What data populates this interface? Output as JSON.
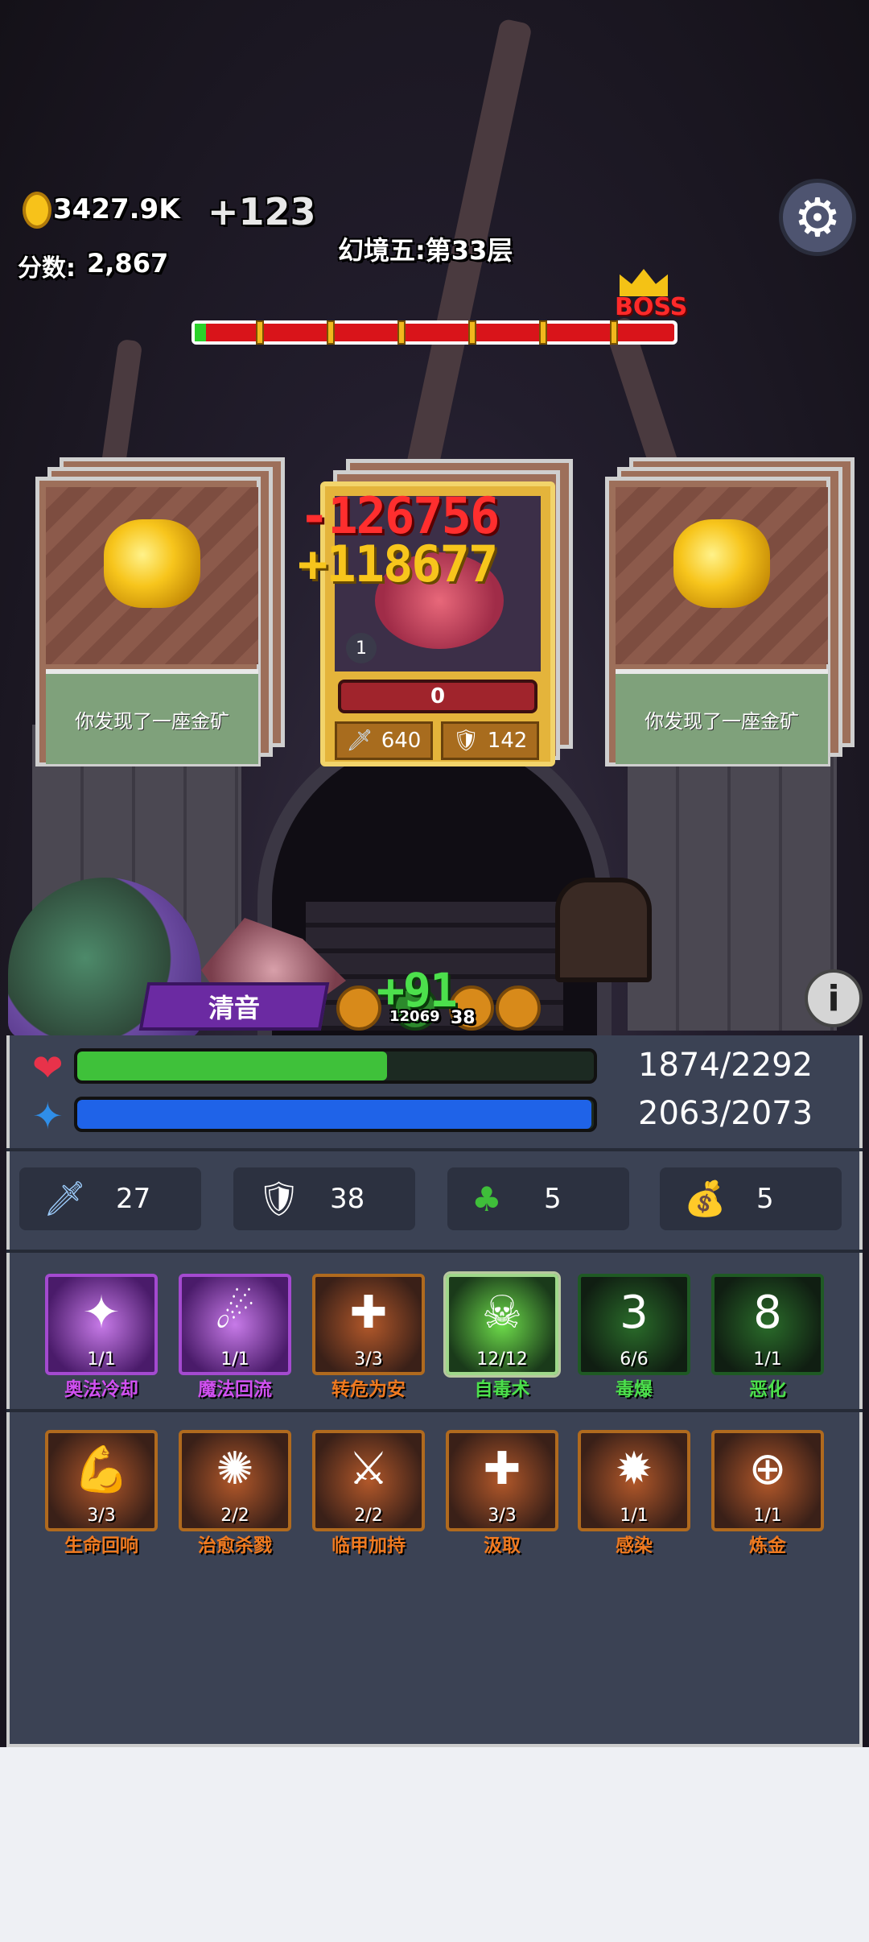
{
  "hud": {
    "coins": "3427.9K",
    "coin_gain": "+123",
    "score_label": "分数:",
    "score": "2,867",
    "stage_title": "幻境五:第33层",
    "boss_label": "BOSS",
    "stage_progress": 0.02
  },
  "cards": [
    {
      "label": "你发现了一座金矿",
      "art": "gold-ore"
    },
    {
      "label": "你发现了一座金矿",
      "art": "gold-ore"
    }
  ],
  "enemy": {
    "level": "1",
    "hp": "0",
    "attack": "640",
    "defense": "142",
    "damage_text": "-126756",
    "heal_text": "+118677"
  },
  "hero": {
    "name": "清音",
    "heal_popup": "+91",
    "buff_values": [
      "12069",
      "38"
    ]
  },
  "bars": {
    "hp": {
      "text": "1874/2292",
      "fraction": 0.6,
      "color": "#3fc13a"
    },
    "mp": {
      "text": "2063/2073",
      "fraction": 0.995,
      "color": "#1f63e8"
    }
  },
  "stats": [
    {
      "icon": "sword-icon",
      "value": "27"
    },
    {
      "icon": "shield-icon",
      "value": "38"
    },
    {
      "icon": "clover-icon",
      "value": "5"
    },
    {
      "icon": "money-bag-icon",
      "value": "5"
    }
  ],
  "skills_row1": [
    {
      "name": "奥法冷却",
      "count": "1/1",
      "style": "purple",
      "color": "#d050f0",
      "glyph": "✦"
    },
    {
      "name": "魔法回流",
      "count": "1/1",
      "style": "purple",
      "color": "#d050f0",
      "glyph": "☄"
    },
    {
      "name": "转危为安",
      "count": "3/3",
      "style": "orange",
      "color": "#f07a20",
      "glyph": "✚"
    },
    {
      "name": "自毒术",
      "count": "12/12",
      "style": "green sel",
      "color": "#4ce04c",
      "glyph": "☠"
    },
    {
      "name": "毒爆",
      "count": "6/6",
      "style": "dark",
      "color": "#4ce04c",
      "glyph": "3"
    },
    {
      "name": "恶化",
      "count": "1/1",
      "style": "dark",
      "color": "#4ce04c",
      "glyph": "8"
    }
  ],
  "skills_row2": [
    {
      "name": "生命回响",
      "count": "3/3",
      "style": "orange",
      "color": "#f07a20",
      "glyph": "💪"
    },
    {
      "name": "治愈杀戮",
      "count": "2/2",
      "style": "orange",
      "color": "#f07a20",
      "glyph": "✺"
    },
    {
      "name": "临甲加持",
      "count": "2/2",
      "style": "orange",
      "color": "#f07a20",
      "glyph": "⚔"
    },
    {
      "name": "汲取",
      "count": "3/3",
      "style": "orange",
      "color": "#f07a20",
      "glyph": "✚"
    },
    {
      "name": "感染",
      "count": "1/1",
      "style": "orange",
      "color": "#f07a20",
      "glyph": "✹"
    },
    {
      "name": "炼金",
      "count": "1/1",
      "style": "orange",
      "color": "#f07a20",
      "glyph": "⊕"
    }
  ]
}
